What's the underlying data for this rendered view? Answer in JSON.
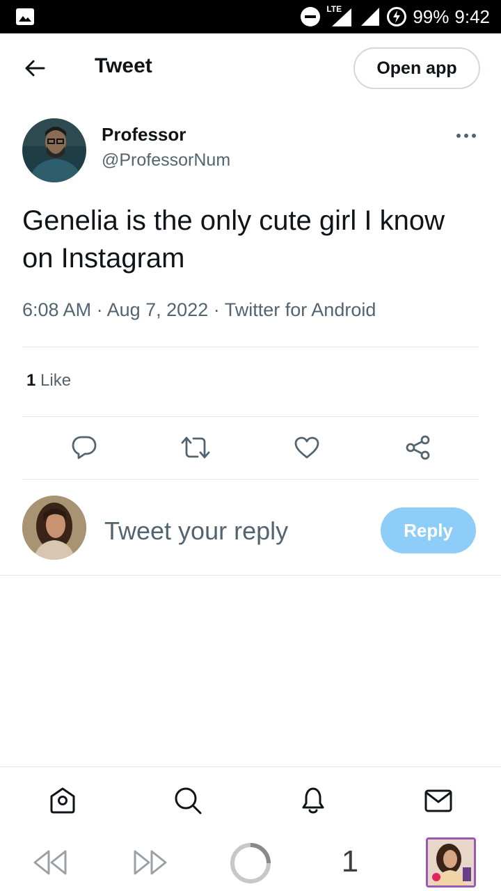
{
  "status_bar": {
    "network": "LTE",
    "battery": "99%",
    "time": "9:42"
  },
  "header": {
    "title": "Tweet",
    "open_app_label": "Open app"
  },
  "tweet": {
    "author_name": "Professor",
    "author_handle": "@ProfessorNum",
    "text": "Genelia is the only cute girl I know on Instagram",
    "time": "6:08 AM",
    "date": "Aug 7, 2022",
    "source": "Twitter for Android",
    "separator": "·",
    "like_count": "1",
    "like_label": "Like"
  },
  "reply": {
    "placeholder": "Tweet your reply",
    "button_label": "Reply"
  },
  "bottom_nav": {
    "items": [
      "home-icon",
      "search-icon",
      "notifications-icon",
      "messages-icon"
    ]
  },
  "browser_toolbar": {
    "tab_count": "1"
  },
  "colors": {
    "accent_disabled": "#8ecdf8",
    "text_primary": "#0f1419",
    "text_secondary": "#536471",
    "divider": "#e1e8ed"
  }
}
